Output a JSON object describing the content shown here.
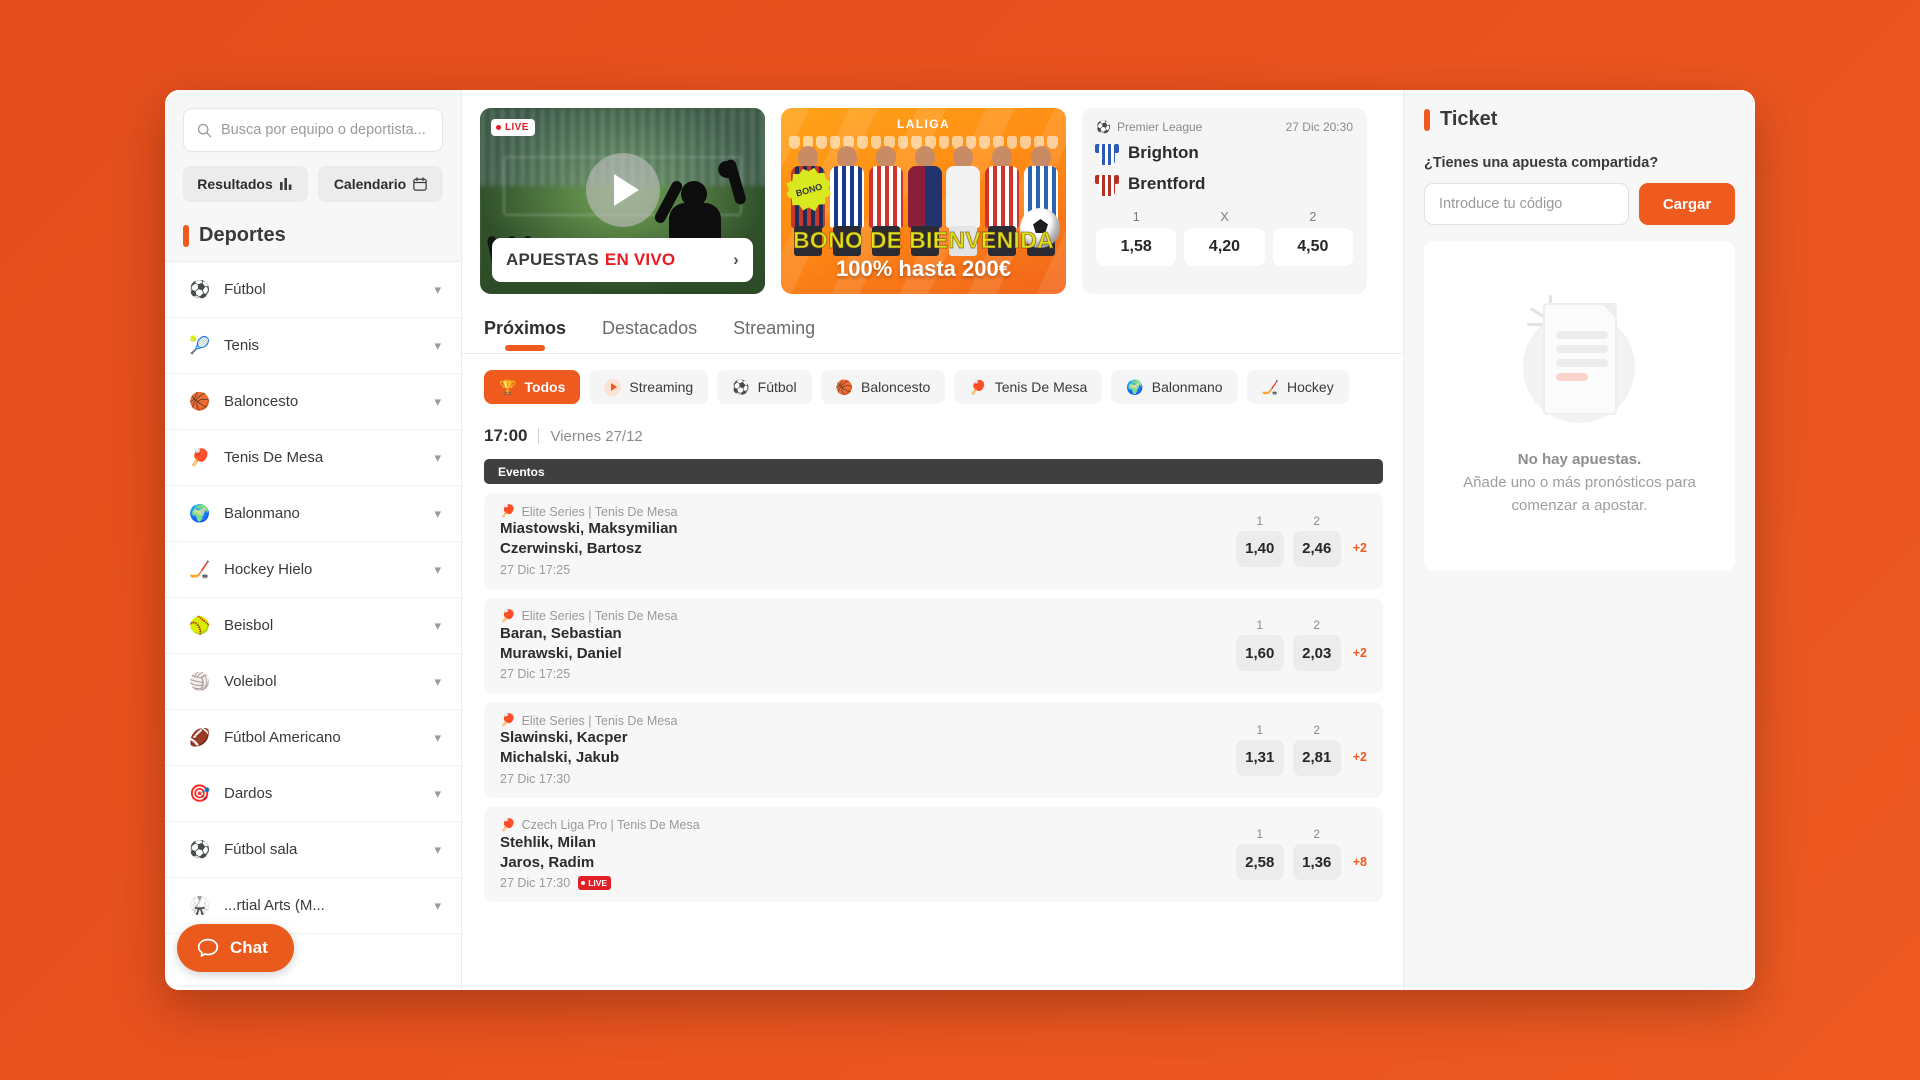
{
  "sidebar": {
    "search": {
      "placeholder": "Busca por equipo o deportista..."
    },
    "segments": [
      {
        "label": "Resultados",
        "icon": "bar-chart-icon"
      },
      {
        "label": "Calendario",
        "icon": "calendar-icon"
      }
    ],
    "section_title": "Deportes",
    "sports": [
      {
        "emoji": "⚽",
        "label": "Fútbol"
      },
      {
        "emoji": "🎾",
        "label": "Tenis"
      },
      {
        "emoji": "🏀",
        "label": "Baloncesto"
      },
      {
        "emoji": "🏓",
        "label": "Tenis De Mesa"
      },
      {
        "emoji": "🌍",
        "label": "Balonmano"
      },
      {
        "emoji": "🏒",
        "label": "Hockey Hielo"
      },
      {
        "emoji": "🥎",
        "label": "Beisbol"
      },
      {
        "emoji": "🏐",
        "label": "Voleibol"
      },
      {
        "emoji": "🏈",
        "label": "Fútbol Americano"
      },
      {
        "emoji": "🎯",
        "label": "Dardos"
      },
      {
        "emoji": "⚽",
        "label": "Fútbol sala"
      },
      {
        "emoji": "🥋",
        "label": "...rtial Arts (M..."
      }
    ],
    "chat": {
      "label": "Chat",
      "icon": "chat-bubble-icon"
    }
  },
  "promos": {
    "live": {
      "badge": "LIVE",
      "cta_primary": "APUESTAS",
      "cta_accent": "EN VIVO",
      "arrow": "›"
    },
    "bonus": {
      "league": "LALIGA",
      "seal": "BONO",
      "title": "BONO DE BIENVENIDA",
      "subtitle": "100% hasta 200€"
    }
  },
  "match_card": {
    "league": "Premier League",
    "league_icon": "soccer-ball-icon",
    "datetime": "27 Dic 20:30",
    "home": "Brighton",
    "away": "Brentford",
    "odds_headers": [
      "1",
      "X",
      "2"
    ],
    "odds": [
      "1,58",
      "4,20",
      "4,50"
    ]
  },
  "tabs": [
    {
      "label": "Próximos",
      "active": true
    },
    {
      "label": "Destacados",
      "active": false
    },
    {
      "label": "Streaming",
      "active": false
    }
  ],
  "chips": [
    {
      "label": "Todos",
      "emoji": "🏆",
      "active": true
    },
    {
      "label": "Streaming",
      "icon": "play-icon",
      "active": false
    },
    {
      "label": "Fútbol",
      "emoji": "⚽",
      "active": false
    },
    {
      "label": "Baloncesto",
      "emoji": "🏀",
      "active": false
    },
    {
      "label": "Tenis De Mesa",
      "emoji": "🏓",
      "active": false
    },
    {
      "label": "Balonmano",
      "emoji": "🌍",
      "active": false
    },
    {
      "label": "Hockey",
      "emoji": "🏒",
      "active": false
    }
  ],
  "date_row": {
    "time": "17:00",
    "date": "Viernes 27/12"
  },
  "events_header": "Eventos",
  "events": [
    {
      "league": "Elite Series | Tenis De Mesa",
      "emoji": "🏓",
      "player1": "Miastowski, Maksymilian",
      "player2": "Czerwinski, Bartosz",
      "time": "27 Dic 17:25",
      "live": false,
      "odds_headers": [
        "1",
        "2"
      ],
      "odds": [
        "1,40",
        "2,46"
      ],
      "more": "+2"
    },
    {
      "league": "Elite Series | Tenis De Mesa",
      "emoji": "🏓",
      "player1": "Baran, Sebastian",
      "player2": "Murawski, Daniel",
      "time": "27 Dic 17:25",
      "live": false,
      "odds_headers": [
        "1",
        "2"
      ],
      "odds": [
        "1,60",
        "2,03"
      ],
      "more": "+2"
    },
    {
      "league": "Elite Series | Tenis De Mesa",
      "emoji": "🏓",
      "player1": "Slawinski, Kacper",
      "player2": "Michalski, Jakub",
      "time": "27 Dic 17:30",
      "live": false,
      "odds_headers": [
        "1",
        "2"
      ],
      "odds": [
        "1,31",
        "2,81"
      ],
      "more": "+2"
    },
    {
      "league": "Czech Liga Pro | Tenis De Mesa",
      "emoji": "🏓",
      "player1": "Stehlik, Milan",
      "player2": "Jaros, Radim",
      "time": "27 Dic 17:30",
      "live": true,
      "live_label": "LIVE",
      "odds_headers": [
        "1",
        "2"
      ],
      "odds": [
        "2,58",
        "1,36"
      ],
      "more": "+8"
    }
  ],
  "ticket": {
    "title": "Ticket",
    "question": "¿Tienes una apuesta compartida?",
    "input_placeholder": "Introduce tu código",
    "load_label": "Cargar",
    "empty_title": "No hay apuestas.",
    "empty_text": "Añade uno o más pronósticos para comenzar a apostar."
  },
  "colors": {
    "accent": "#ef5b1f",
    "background": "#e8501e",
    "live_red": "#e01f26",
    "dark": "#3f3f3f"
  }
}
